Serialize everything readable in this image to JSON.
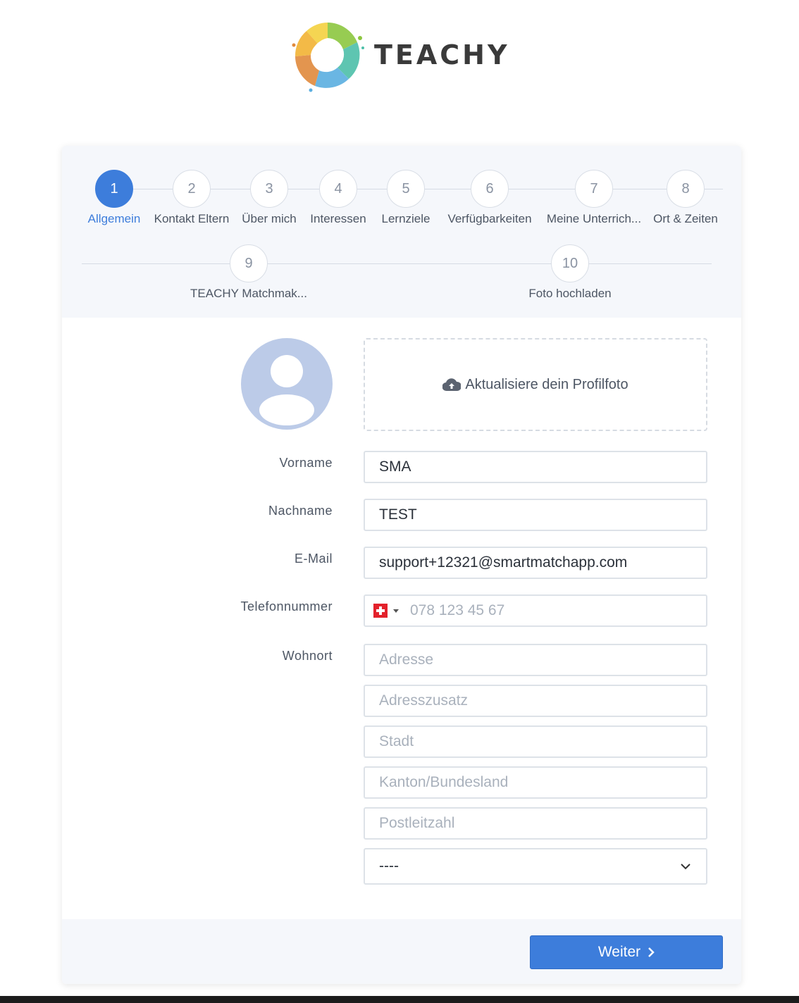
{
  "brand": {
    "name": "TEACHY"
  },
  "stepper": {
    "steps": [
      {
        "number": "1",
        "label": "Allgemein",
        "active": true
      },
      {
        "number": "2",
        "label": "Kontakt Eltern"
      },
      {
        "number": "3",
        "label": "Über mich"
      },
      {
        "number": "4",
        "label": "Interessen"
      },
      {
        "number": "5",
        "label": "Lernziele"
      },
      {
        "number": "6",
        "label": "Verfügbarkeiten"
      },
      {
        "number": "7",
        "label": "Meine Unterrich..."
      },
      {
        "number": "8",
        "label": "Ort & Zeiten"
      },
      {
        "number": "9",
        "label": "TEACHY Matchmak..."
      },
      {
        "number": "10",
        "label": "Foto hochladen"
      }
    ]
  },
  "profile": {
    "upload_label": "Aktualisiere dein Profilfoto"
  },
  "form": {
    "vorname": {
      "label": "Vorname",
      "value": "SMA"
    },
    "nachname": {
      "label": "Nachname",
      "value": "TEST"
    },
    "email": {
      "label": "E-Mail",
      "value": "support+12321@smartmatchapp.com"
    },
    "telefon": {
      "label": "Telefonnummer",
      "placeholder": "078 123 45 67",
      "country": "CH"
    },
    "wohnort": {
      "label": "Wohnort",
      "adresse_placeholder": "Adresse",
      "adresszusatz_placeholder": "Adresszusatz",
      "stadt_placeholder": "Stadt",
      "kanton_placeholder": "Kanton/Bundesland",
      "plz_placeholder": "Postleitzahl",
      "country_select_value": "----"
    }
  },
  "footer": {
    "next_label": "Weiter"
  },
  "colors": {
    "primary": "#3d7ddb",
    "avatar_bg": "#bccbe8",
    "stepper_bg": "#f5f7fb"
  }
}
